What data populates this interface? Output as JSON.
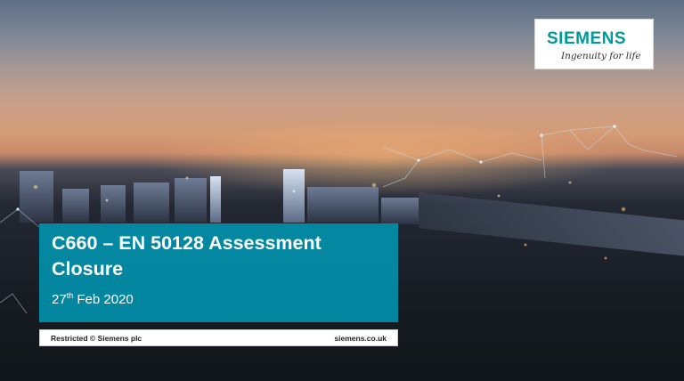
{
  "slide": {
    "logo": {
      "brand": "SIEMENS",
      "tagline": "Ingenuity for life",
      "brand_color": "#009999"
    },
    "title": "C660 – EN 50128 Assessment Closure",
    "date": {
      "day": "27",
      "suffix": "th",
      "rest": " Feb 2020"
    },
    "footer": {
      "left": "Restricted © Siemens plc",
      "right": "siemens.co.uk"
    },
    "colors": {
      "title_panel": "#0099b4",
      "title_text": "#ffffff"
    }
  }
}
